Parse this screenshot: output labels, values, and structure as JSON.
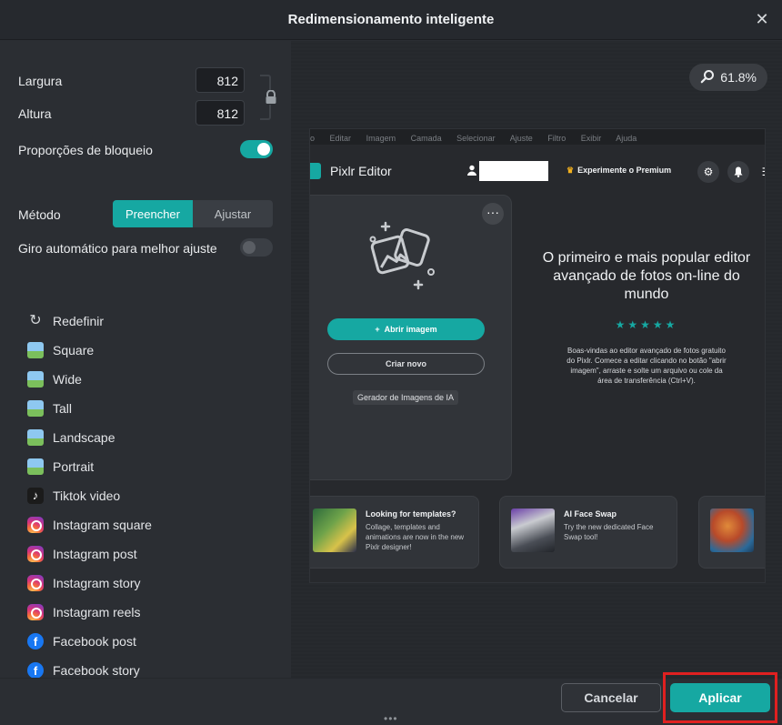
{
  "dialog": {
    "title": "Redimensionamento inteligente"
  },
  "size": {
    "width_label": "Largura",
    "width_value": "812",
    "height_label": "Altura",
    "height_value": "812",
    "lock_label": "Proporções de bloqueio",
    "lock_on": true
  },
  "method": {
    "label": "Método",
    "options": [
      "Preencher",
      "Ajustar"
    ],
    "selected": "Preencher"
  },
  "auto_rotate": {
    "label": "Giro automático para melhor ajuste",
    "on": false
  },
  "presets": [
    {
      "label": "Redefinir",
      "icon": "reset-icon"
    },
    {
      "label": "Square",
      "icon": "image-icon"
    },
    {
      "label": "Wide",
      "icon": "image-icon"
    },
    {
      "label": "Tall",
      "icon": "image-icon"
    },
    {
      "label": "Landscape",
      "icon": "image-icon"
    },
    {
      "label": "Portrait",
      "icon": "image-icon"
    },
    {
      "label": "Tiktok video",
      "icon": "tiktok-icon"
    },
    {
      "label": "Instagram square",
      "icon": "instagram-icon"
    },
    {
      "label": "Instagram post",
      "icon": "instagram-icon"
    },
    {
      "label": "Instagram story",
      "icon": "instagram-icon"
    },
    {
      "label": "Instagram reels",
      "icon": "instagram-icon"
    },
    {
      "label": "Facebook post",
      "icon": "facebook-icon"
    },
    {
      "label": "Facebook story",
      "icon": "facebook-icon"
    }
  ],
  "zoom": {
    "value": "61.8%"
  },
  "preview": {
    "menu": [
      "o",
      "Editar",
      "Imagem",
      "Camada",
      "Selecionar",
      "Ajuste",
      "Filtro",
      "Exibir",
      "Ajuda"
    ],
    "app_name": "Pixlr Editor",
    "premium": "Experimente o Premium",
    "open_image": "Abrir imagem",
    "create_new": "Criar novo",
    "ai_generator": "Gerador de Imagens de IA",
    "headline": "O primeiro e mais popular editor avançado de fotos on-line do mundo",
    "stars": "★★★★★",
    "description": "Boas-vindas ao editor avançado de fotos gratuito do Pixlr. Comece a editar clicando no botão \"abrir imagem\", arraste e solte um arquivo ou cole da área de transferência (Ctrl+V).",
    "promos": [
      {
        "title": "Looking for templates?",
        "text": "Collage, templates and animations are now in the new Pixlr designer!"
      },
      {
        "title": "AI Face Swap",
        "text": "Try the new dedicated Face Swap tool!"
      }
    ]
  },
  "footer": {
    "cancel": "Cancelar",
    "apply": "Aplicar"
  },
  "colors": {
    "accent": "#16a8a2",
    "highlight": "#e02020",
    "background": "#2b2e33"
  }
}
